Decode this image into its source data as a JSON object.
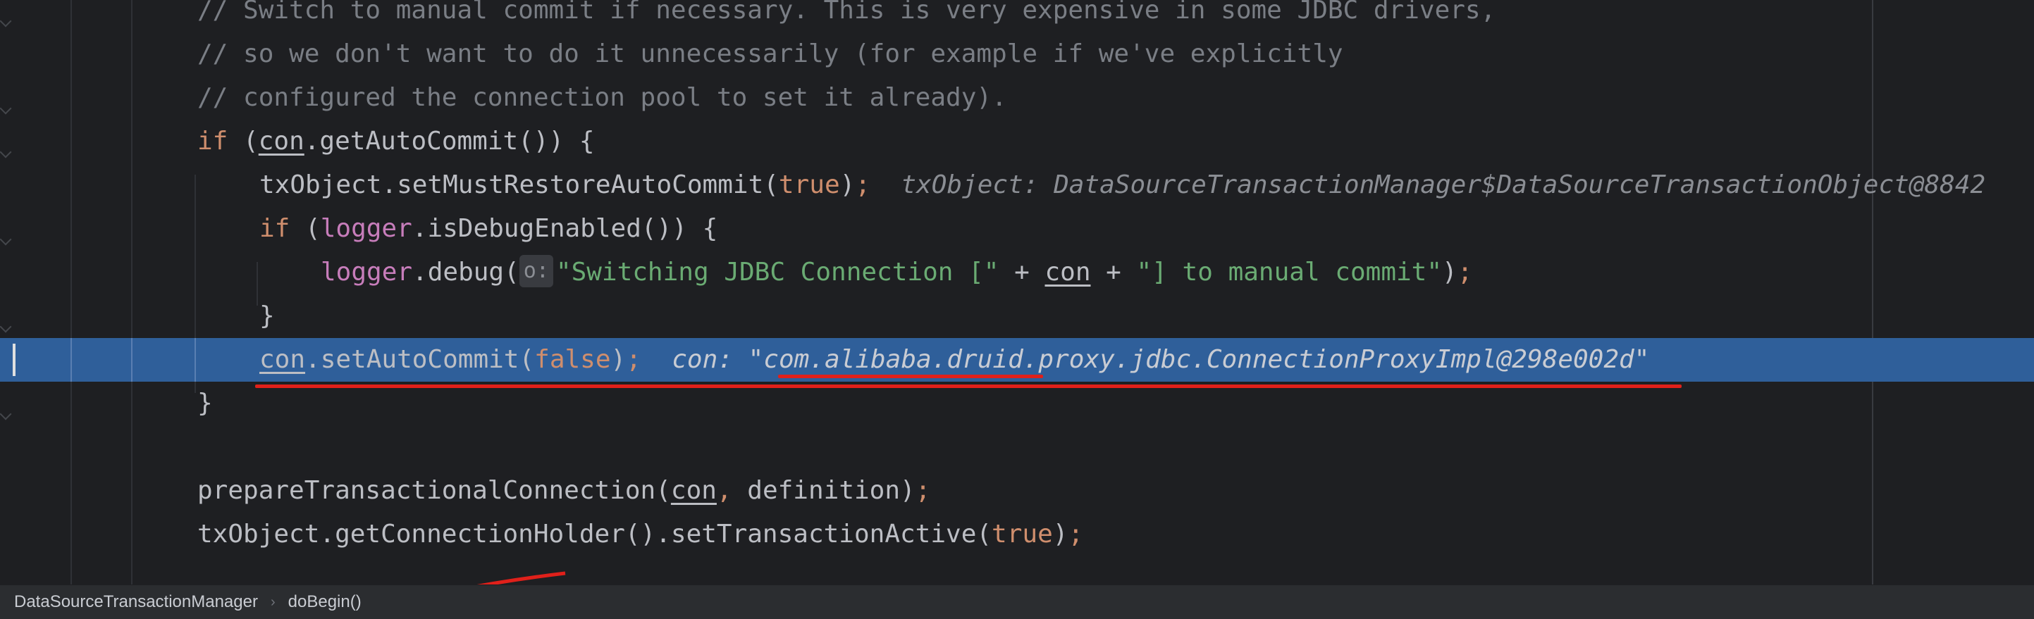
{
  "editor": {
    "lines": [
      {
        "id": "l1",
        "indent": 280,
        "tokens": [
          {
            "t": "cm",
            "v": "// Switch to manual commit if necessary. This is very expensive in some JDBC drivers,"
          }
        ]
      },
      {
        "id": "l2",
        "indent": 280,
        "tokens": [
          {
            "t": "cm",
            "v": "// so we don't want to do it unnecessarily (for example if we've explicitly"
          }
        ]
      },
      {
        "id": "l3",
        "indent": 280,
        "tokens": [
          {
            "t": "cm",
            "v": "// configured the connection pool to set it already)."
          }
        ]
      },
      {
        "id": "l4",
        "indent": 280,
        "tokens": [
          {
            "t": "kw",
            "v": "if "
          },
          {
            "t": "fn",
            "v": "("
          },
          {
            "t": "var",
            "v": "con"
          },
          {
            "t": "fn",
            "v": ".getAutoCommit()) {"
          }
        ]
      },
      {
        "id": "l5",
        "indent": 368,
        "tokens": [
          {
            "t": "fn",
            "v": "txObject.setMustRestoreAutoCommit("
          },
          {
            "t": "kw",
            "v": "true"
          },
          {
            "t": "fn",
            "v": ")"
          },
          {
            "t": "kw",
            "v": ";"
          },
          {
            "t": "inlay",
            "v": "  txObject: DataSourceTransactionManager$DataSourceTransactionObject@8842"
          }
        ]
      },
      {
        "id": "l6",
        "indent": 368,
        "tokens": [
          {
            "t": "kw",
            "v": "if "
          },
          {
            "t": "fn",
            "v": "("
          },
          {
            "t": "fld",
            "v": "logger"
          },
          {
            "t": "fn",
            "v": ".isDebugEnabled()) {"
          }
        ]
      },
      {
        "id": "l7",
        "indent": 455,
        "tokens": [
          {
            "t": "fld",
            "v": "logger"
          },
          {
            "t": "fn",
            "v": ".debug("
          },
          {
            "t": "hint",
            "v": "o:"
          },
          {
            "t": "str",
            "v": "\"Switching JDBC Connection [\""
          },
          {
            "t": "fn",
            "v": " + "
          },
          {
            "t": "var",
            "v": "con"
          },
          {
            "t": "fn",
            "v": " + "
          },
          {
            "t": "str",
            "v": "\"] to manual commit\""
          },
          {
            "t": "fn",
            "v": ")"
          },
          {
            "t": "kw",
            "v": ";"
          }
        ]
      },
      {
        "id": "l8",
        "indent": 368,
        "tokens": [
          {
            "t": "fn",
            "v": "}"
          }
        ]
      },
      {
        "id": "l9",
        "indent": 368,
        "highlight": true,
        "tokens": [
          {
            "t": "var",
            "v": "con"
          },
          {
            "t": "fn",
            "v": ".setAutoCommit("
          },
          {
            "t": "kw",
            "v": "false"
          },
          {
            "t": "fn",
            "v": ")"
          },
          {
            "t": "kw",
            "v": ";"
          },
          {
            "t": "hlinlay",
            "v": "  con: \"com.alibaba.druid.proxy.jdbc.ConnectionProxyImpl@298e002d\""
          }
        ]
      },
      {
        "id": "l10",
        "indent": 280,
        "tokens": [
          {
            "t": "fn",
            "v": "}"
          }
        ]
      },
      {
        "id": "l11",
        "indent": 280,
        "tokens": []
      },
      {
        "id": "l12",
        "indent": 280,
        "tokens": [
          {
            "t": "fn",
            "v": "prepareTransactionalConnection("
          },
          {
            "t": "var",
            "v": "con"
          },
          {
            "t": "kw",
            "v": ","
          },
          {
            "t": "fn",
            "v": " definition)"
          },
          {
            "t": "kw",
            "v": ";"
          }
        ]
      },
      {
        "id": "l13",
        "indent": 280,
        "tokens": [
          {
            "t": "fn",
            "v": "txObject.getConnectionHolder().setTransactionActive("
          },
          {
            "t": "kw",
            "v": "true"
          },
          {
            "t": "fn",
            "v": ")"
          },
          {
            "t": "kw",
            "v": ";"
          }
        ]
      }
    ]
  },
  "breadcrumb": {
    "class_name": "DataSourceTransactionManager",
    "method_name": "doBegin()"
  },
  "colors": {
    "background": "#1e1f22",
    "highlight": "#2f5f9a",
    "annotation": "#e0201a"
  }
}
